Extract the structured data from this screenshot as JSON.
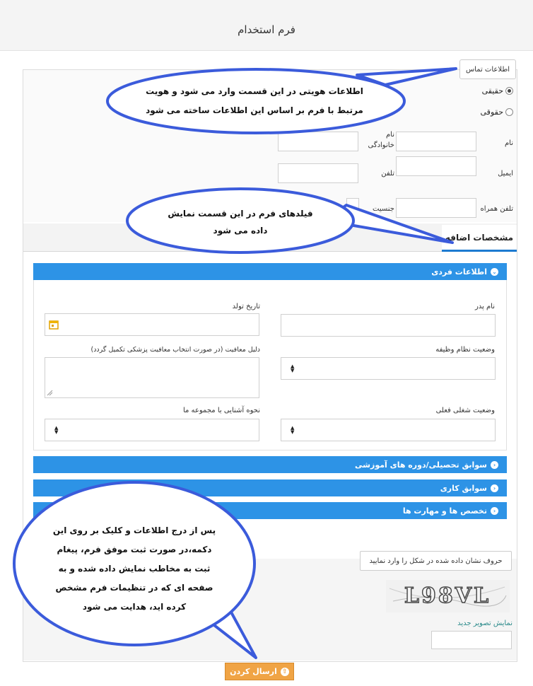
{
  "header": {
    "title": "فرم استخدام"
  },
  "contact": {
    "legend": "اطلاعات تماس",
    "radio_real": "حقیقی",
    "radio_legal": "حقوقی",
    "name_label": "نام",
    "family_label": "نام خانوادگی",
    "email_label": "ایمیل",
    "phone_label": "تلفن",
    "mobile_label": "تلفن همراه",
    "gender_label": "جنسیت"
  },
  "tabs": {
    "extra": "مشخصات اضافه"
  },
  "personal": {
    "title": "اطلاعات فردی",
    "father_name_label": "نام پدر",
    "birth_date_label": "تاریخ تولد",
    "military_label": "وضعیت نظام وظیفه",
    "exemption_label": "دلیل معافیت (در صورت انتخاب معافیت پزشکی تکمیل گردد)",
    "job_status_label": "وضعیت شغلی فعلی",
    "acquaint_label": "نحوه آشنایی با مجموعه ما"
  },
  "sections": {
    "education": "سوابق تحصیلی/دوره های آموزشی",
    "work": "سوابق کاری",
    "skills": "تخصص ها و مهارت ها"
  },
  "captcha": {
    "label": "حروف نشان داده شده در شکل را وارد نمایید",
    "image_text": "L98VL",
    "refresh_link": "نمایش تصویر جدید"
  },
  "submit": {
    "label": "ارسال کردن"
  },
  "callouts": {
    "identity_line1": "اطلاعات هویتی در این قسمت وارد می شود و هویت",
    "identity_line2": "مرتبط با فرم بر اساس این اطلاعات ساخته می شود",
    "fields_line1": "فیلدهای فرم در این قسمت نمایش",
    "fields_line2": "داده می شود",
    "submit_line1": "پس از درج اطلاعات و کلیک بر روی این",
    "submit_line2": "دکمه،در صورت ثبت موفق فرم، پیغام",
    "submit_line3": "ثبت به مخاطب نمایش داده شده و به",
    "submit_line4": "صفحه ای که در تنظیمات فرم مشخص",
    "submit_line5": "کرده اید، هدایت می شود"
  },
  "colors": {
    "section_blue": "#2d93e6",
    "submit_orange": "#f0a445",
    "callout_border": "#3b5bdb",
    "tab_underline": "#1d7bd1"
  }
}
